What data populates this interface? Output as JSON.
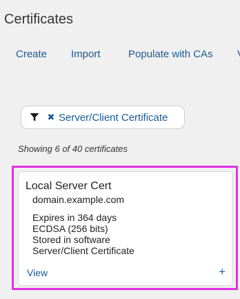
{
  "header": {
    "title": "Certificates"
  },
  "toolbar": {
    "create_label": "Create",
    "import_label": "Import",
    "populate_label": "Populate with CAs",
    "overflow_label": "V"
  },
  "filter": {
    "icon": "funnel-icon",
    "close_icon": "close-icon",
    "label": "Server/Client Certificate"
  },
  "results": {
    "summary": "Showing 6 of 40 certificates"
  },
  "certificate": {
    "name": "Local Server Cert",
    "domain": "domain.example.com",
    "expiry": "Expires in 364 days",
    "key_type": "ECDSA (256 bits)",
    "storage": "Stored in software",
    "type": "Server/Client Certificate",
    "view_label": "View",
    "expand_label": "+"
  },
  "colors": {
    "link": "#1a5a96",
    "highlight": "#e22fe6",
    "background": "#f0f0f0"
  }
}
